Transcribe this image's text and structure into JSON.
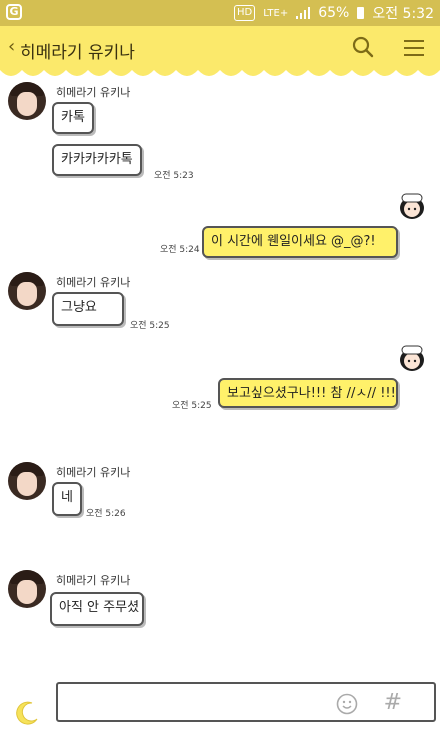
{
  "status_bar": {
    "app_icon": "G",
    "hd_badge": "HD",
    "network": "LTE+",
    "battery": "65%",
    "time": "오전 5:32"
  },
  "header": {
    "title": "히메라기 유키나"
  },
  "messages": [
    {
      "from": "other",
      "sender": "히메라기 유키나",
      "text": "카톡"
    },
    {
      "from": "other",
      "text": "카카카카카톡",
      "time": "오전 5:23"
    },
    {
      "from": "me",
      "text": "이 시간에 웬일이세요 @_@?!",
      "time": "오전 5:24"
    },
    {
      "from": "other",
      "sender": "히메라기 유키나",
      "text": "그냥요",
      "time": "오전 5:25"
    },
    {
      "from": "me",
      "text": "보고싶으셨구나!!! 참 //ㅅ// !!!",
      "time": "오전 5:25"
    },
    {
      "from": "other",
      "sender": "히메라기 유키나",
      "text": "네",
      "time": "오전 5:26"
    },
    {
      "from": "other",
      "sender": "히메라기 유키나",
      "text": "아직 안 주무셨"
    }
  ],
  "input": {
    "placeholder": "",
    "value": ""
  },
  "colors": {
    "status_bar": "#d4bf52",
    "header": "#fbe96b",
    "my_bubble": "#fff16a",
    "other_bubble": "#ffffff"
  },
  "icons": [
    "back-chevron-icon",
    "search-icon",
    "menu-icon",
    "moon-icon",
    "emoji-icon",
    "hash-icon"
  ]
}
